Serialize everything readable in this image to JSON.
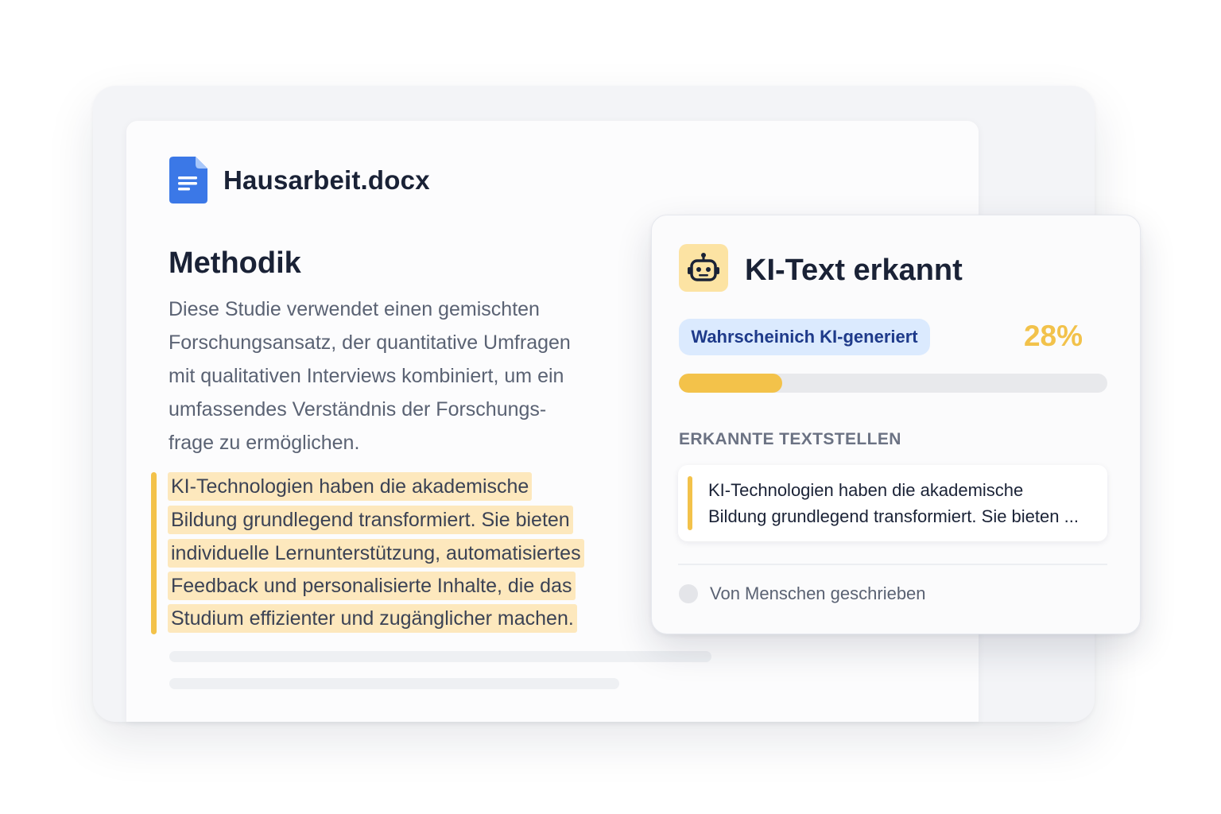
{
  "document": {
    "file_name": "Hausarbeit.docx",
    "file_icon": "document-icon",
    "section_heading": "Methodik",
    "paragraph_lines": [
      "Diese Studie verwendet einen gemischten",
      "Forschungsansatz, der quantitative Umfragen",
      "mit qualitativen Interviews kombiniert, um ein",
      "umfassendes Verständnis der Forschungs-",
      "frage zu ermöglichen."
    ],
    "highlighted_lines": [
      "KI-Technologien haben die akademische",
      "Bildung grundlegend transformiert. Sie bieten",
      "individuelle Lernunterstützung, automatisiertes",
      "Feedback und personalisierte Inhalte, die das",
      "Studium effizienter und zugänglicher machen."
    ]
  },
  "ki_panel": {
    "icon": "robot-icon",
    "title": "KI-Text erkannt",
    "badge": "Wahrscheinich KI-generiert",
    "percent_label": "28%",
    "progress": 0.28,
    "passages_heading": "ERKANNTE TEXTSTELLEN",
    "passage_lines": [
      "KI-Technologien haben die akademische",
      "Bildung grundlegend transformiert. Sie bieten ..."
    ],
    "human_label": "Von Menschen geschrieben"
  },
  "colors": {
    "accent_yellow": "#f3c24a",
    "highlight_bg": "#fde8bd",
    "badge_bg": "#dbeafe",
    "badge_text": "#1e3a8a",
    "doc_icon_blue": "#3b78e7"
  }
}
